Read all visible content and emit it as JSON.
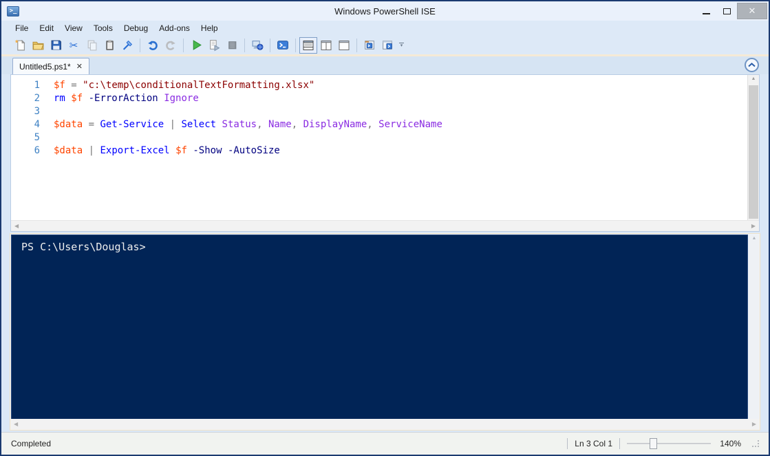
{
  "window": {
    "title": "Windows PowerShell ISE",
    "controls": {
      "minimize": "–",
      "maximize": "□",
      "close": "✕"
    }
  },
  "menu": {
    "items": [
      "File",
      "Edit",
      "View",
      "Tools",
      "Debug",
      "Add-ons",
      "Help"
    ]
  },
  "toolbar": {
    "icon_names": [
      "new-script-icon",
      "open-script-icon",
      "save-icon",
      "cut-icon",
      "copy-icon",
      "paste-icon",
      "clear-console-pane-icon",
      "undo-icon",
      "redo-icon",
      "run-script-icon",
      "run-selection-icon",
      "stop-operation-icon",
      "new-remote-powershell-tab-icon",
      "start-powershell-icon",
      "layout-script-pane-top-icon",
      "layout-script-pane-right-icon",
      "layout-script-pane-maximized-icon",
      "new-powershell-tab-icon",
      "show-script-pane-icon",
      "toolbar-overflow-icon"
    ]
  },
  "tabs": [
    {
      "label": "Untitled5.ps1*",
      "close_glyph": "✕",
      "active": true
    }
  ],
  "editor": {
    "token_colors": {
      "variable": "#ff4500",
      "operator": "#757575",
      "string": "#8b0000",
      "cmdlet": "#0000ff",
      "parameter": "#000080",
      "argument": "#8a2be2",
      "plain": "#000000"
    },
    "lines": [
      {
        "num": "1",
        "tokens": [
          {
            "t": "$f",
            "c": "variable"
          },
          {
            "t": " ",
            "c": "plain"
          },
          {
            "t": "=",
            "c": "operator"
          },
          {
            "t": " ",
            "c": "plain"
          },
          {
            "t": "\"c:\\temp\\conditionalTextFormatting.xlsx\"",
            "c": "string"
          }
        ]
      },
      {
        "num": "2",
        "tokens": [
          {
            "t": "rm",
            "c": "cmdlet"
          },
          {
            "t": " ",
            "c": "plain"
          },
          {
            "t": "$f",
            "c": "variable"
          },
          {
            "t": " ",
            "c": "plain"
          },
          {
            "t": "-ErrorAction",
            "c": "parameter"
          },
          {
            "t": " ",
            "c": "plain"
          },
          {
            "t": "Ignore",
            "c": "argument"
          }
        ]
      },
      {
        "num": "3",
        "tokens": []
      },
      {
        "num": "4",
        "tokens": [
          {
            "t": "$data",
            "c": "variable"
          },
          {
            "t": " ",
            "c": "plain"
          },
          {
            "t": "=",
            "c": "operator"
          },
          {
            "t": " ",
            "c": "plain"
          },
          {
            "t": "Get-Service",
            "c": "cmdlet"
          },
          {
            "t": " ",
            "c": "plain"
          },
          {
            "t": "|",
            "c": "operator"
          },
          {
            "t": " ",
            "c": "plain"
          },
          {
            "t": "Select",
            "c": "cmdlet"
          },
          {
            "t": " ",
            "c": "plain"
          },
          {
            "t": "Status",
            "c": "argument"
          },
          {
            "t": ",",
            "c": "operator"
          },
          {
            "t": " ",
            "c": "plain"
          },
          {
            "t": "Name",
            "c": "argument"
          },
          {
            "t": ",",
            "c": "operator"
          },
          {
            "t": " ",
            "c": "plain"
          },
          {
            "t": "DisplayName",
            "c": "argument"
          },
          {
            "t": ",",
            "c": "operator"
          },
          {
            "t": " ",
            "c": "plain"
          },
          {
            "t": "ServiceName",
            "c": "argument"
          }
        ]
      },
      {
        "num": "5",
        "tokens": []
      },
      {
        "num": "6",
        "tokens": [
          {
            "t": "$data",
            "c": "variable"
          },
          {
            "t": " ",
            "c": "plain"
          },
          {
            "t": "|",
            "c": "operator"
          },
          {
            "t": " ",
            "c": "plain"
          },
          {
            "t": "Export-Excel",
            "c": "cmdlet"
          },
          {
            "t": " ",
            "c": "plain"
          },
          {
            "t": "$f",
            "c": "variable"
          },
          {
            "t": " ",
            "c": "plain"
          },
          {
            "t": "-Show",
            "c": "parameter"
          },
          {
            "t": " ",
            "c": "plain"
          },
          {
            "t": "-AutoSize",
            "c": "parameter"
          }
        ]
      }
    ]
  },
  "console": {
    "prompt": "PS C:\\Users\\Douglas>"
  },
  "status": {
    "left": "Completed",
    "line_col": "Ln 3 Col 1",
    "zoom_label": "140%",
    "zoom_slider_percent": 31
  },
  "glyphs": {
    "cut": "✂",
    "scroll_up": "▲",
    "scroll_left": "◀",
    "scroll_right": "▶",
    "overflow_arrow": "▾"
  }
}
